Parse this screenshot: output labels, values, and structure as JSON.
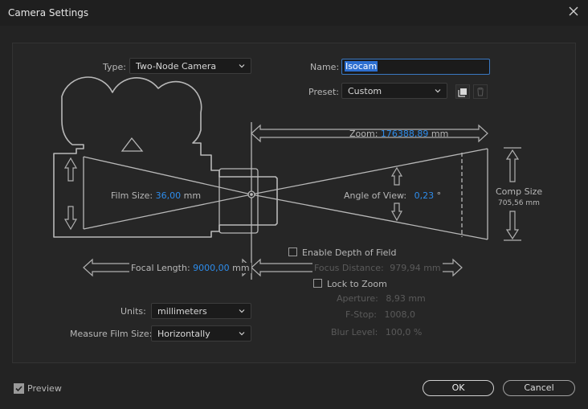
{
  "window": {
    "title": "Camera Settings"
  },
  "type": {
    "label": "Type:",
    "value": "Two-Node Camera"
  },
  "name": {
    "label": "Name:",
    "value": "Isocam"
  },
  "preset": {
    "label": "Preset:",
    "value": "Custom"
  },
  "zoom": {
    "label": "Zoom:",
    "value": "176388,89",
    "unit": "mm"
  },
  "film_size": {
    "label": "Film Size:",
    "value": "36,00",
    "unit": "mm"
  },
  "angle_of_view": {
    "label": "Angle of View:",
    "value": "0,23",
    "unit": "°"
  },
  "comp_size": {
    "label": "Comp Size",
    "value": "705,56 mm"
  },
  "focal_length": {
    "label": "Focal Length:",
    "value": "9000,00",
    "unit": "mm"
  },
  "depth_of_field": {
    "label": "Enable Depth of Field",
    "checked": false
  },
  "focus_distance": {
    "label": "Focus Distance:",
    "value": "979,94",
    "unit": "mm"
  },
  "lock_to_zoom": {
    "label": "Lock to Zoom",
    "checked": false
  },
  "aperture": {
    "label": "Aperture:",
    "value": "8,93",
    "unit": "mm"
  },
  "f_stop": {
    "label": "F-Stop:",
    "value": "1008,0"
  },
  "blur_level": {
    "label": "Blur Level:",
    "value": "100,0",
    "unit": "%"
  },
  "units": {
    "label": "Units:",
    "value": "millimeters"
  },
  "measure_film_size": {
    "label": "Measure Film Size:",
    "value": "Horizontally"
  },
  "preview": {
    "label": "Preview",
    "checked": true
  },
  "buttons": {
    "ok": "OK",
    "cancel": "Cancel"
  },
  "colors": {
    "accent": "#2d8ceb",
    "background": "#232323",
    "panel": "#262626",
    "line": "#b8b8b8"
  }
}
